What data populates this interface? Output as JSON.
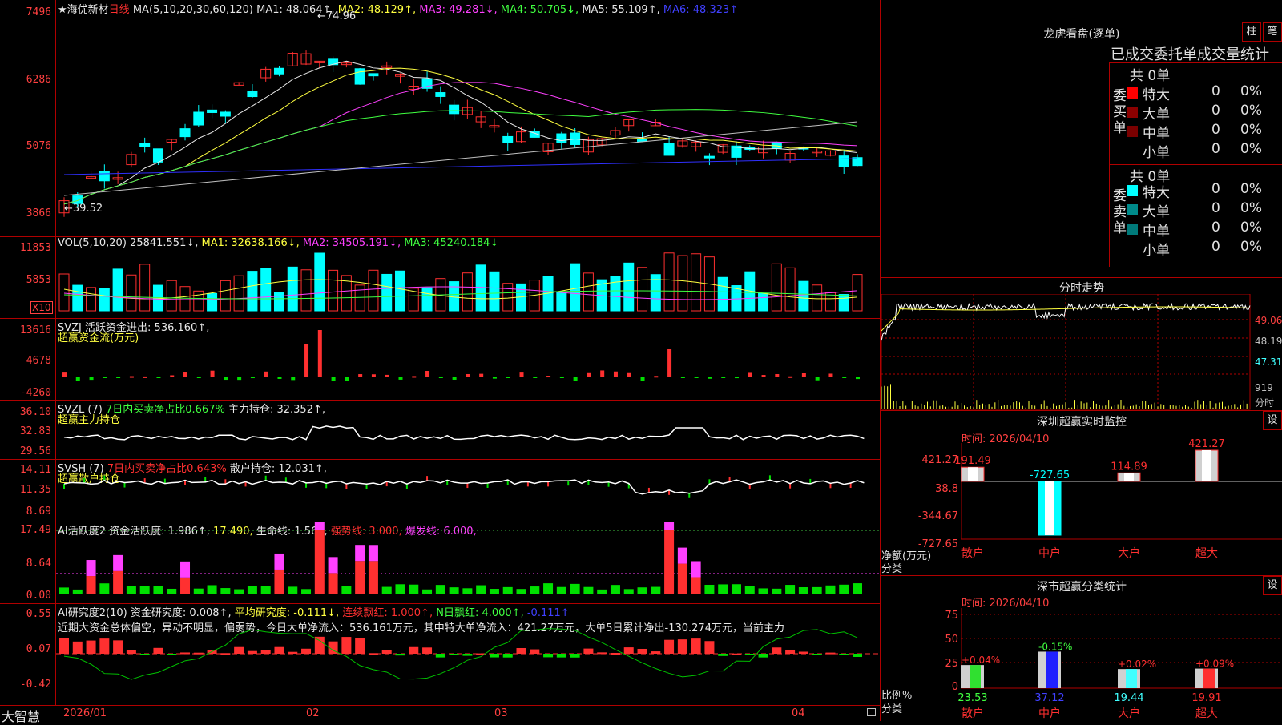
{
  "stock": {
    "name": "海优新材",
    "period": "日线"
  },
  "main": {
    "ma_params": "MA(5,10,20,30,60,120)",
    "ma1": "MA1: 48.064↑,",
    "ma2": "MA2: 48.129↑,",
    "ma3": "MA3: 49.281↓,",
    "ma4": "MA4: 50.705↓,",
    "ma5": "MA5: 55.109↑,",
    "ma6": "MA6: 48.323↑",
    "high_label": "74.96",
    "low_label": "39.52",
    "y_labels": [
      "7496",
      "6286",
      "5076",
      "3866"
    ]
  },
  "vol": {
    "params": "VOL(5,10,20)",
    "value": "25841.551↓,",
    "ma1": "MA1: 32638.166↓,",
    "ma2": "MA2: 34505.191↓,",
    "ma3": "MA3: 45240.184↓",
    "y_labels": [
      "11853",
      "5853"
    ],
    "unit": "X10"
  },
  "svzj": {
    "name": "SVZJ",
    "text": "活跃资金进出: 536.160↑,",
    "sub": "超赢资金流(万元)",
    "y_labels": [
      "13616",
      "4678",
      "-4260"
    ]
  },
  "svzl": {
    "name": "SVZL (7)",
    "ratio": "7日内买卖净占比0.667%",
    "hold": "主力持仓: 32.352↑,",
    "sub": "超赢主力持仓",
    "y_labels": [
      "36.10",
      "32.83",
      "29.56"
    ]
  },
  "svsh": {
    "name": "SVSH (7)",
    "ratio": "7日内买卖净占比0.643%",
    "hold": "散户持仓: 12.031↑,",
    "sub": "超赢散户持仓",
    "y_labels": [
      "14.11",
      "11.35",
      "8.69"
    ]
  },
  "ai2": {
    "name": "AI活跃度2",
    "activity": "资金活跃度: 1.986↑,",
    "v2": "17.490,",
    "life": "生命线: 1.560,",
    "strong": "强势线: 3.000,",
    "burst": "爆发线: 6.000,",
    "y_labels": [
      "17.49",
      "8.64",
      "0.00"
    ]
  },
  "ai_research": {
    "name": "AI研究度2(10)",
    "research": "资金研究度: 0.008↑,",
    "avg": "平均研究度: -0.111↓,",
    "consec": "连续飘红: 1.000↑,",
    "nday": "N日飘红: 4.000↑,",
    "last": "-0.111↑",
    "comment": "近期大资金总体偏空，异动不明显，偏弱势，今日大单净流入：536.161万元，其中特大单净流入：421.27万元，大单5日累计净出-130.274万元，当前主力",
    "y_labels": [
      "0.55",
      "0.07",
      "-0.42"
    ]
  },
  "x_axis": {
    "brand": "大智慧",
    "labels": [
      "2026/01",
      "02",
      "03",
      "04"
    ]
  },
  "right": {
    "lhb": {
      "title": "龙虎看盘(逐单)",
      "btn_bar": "柱",
      "btn_tick": "笔",
      "header": "已成交委托单成交量统计",
      "buy_side": "委买单",
      "sell_side": "委卖单",
      "buy_total": "共 0单",
      "sell_total": "共 0单",
      "buy_rows": [
        {
          "label": "特大",
          "count": "0",
          "pct": "0%",
          "color": "#ff0000"
        },
        {
          "label": "大单",
          "count": "0",
          "pct": "0%",
          "color": "#8b0000"
        },
        {
          "label": "中单",
          "count": "0",
          "pct": "0%",
          "color": "#7a0000"
        },
        {
          "label": "小单",
          "count": "0",
          "pct": "0%",
          "color": "#000000"
        }
      ],
      "sell_rows": [
        {
          "label": "特大",
          "count": "0",
          "pct": "0%",
          "color": "#00ffff"
        },
        {
          "label": "大单",
          "count": "0",
          "pct": "0%",
          "color": "#008b8b"
        },
        {
          "label": "中单",
          "count": "0",
          "pct": "0%",
          "color": "#007a7a"
        },
        {
          "label": "小单",
          "count": "0",
          "pct": "0%",
          "color": "#000000"
        }
      ]
    },
    "intraday": {
      "title": "分时走势",
      "y_labels": [
        "49.06",
        "48.19",
        "47.31",
        "919",
        "分时"
      ]
    },
    "sz_monitor": {
      "title": "深圳超赢实时监控",
      "btn": "设",
      "time": "时间: 2026/04/10",
      "y_labels": [
        "421.27",
        "38.8",
        "-344.67",
        "-727.65"
      ],
      "axis_title": "净额(万元)",
      "axis_sub": "分类",
      "categories": [
        "散户",
        "中户",
        "大户",
        "超大"
      ],
      "values": [
        "191.49",
        "-727.65",
        "114.89",
        "421.27"
      ]
    },
    "sz_class": {
      "title": "深市超赢分类统计",
      "btn": "设",
      "time": "时间: 2026/04/10",
      "y_labels": [
        "75",
        "50",
        "25",
        "0"
      ],
      "axis_title": "比例%",
      "axis_sub": "分类",
      "categories": [
        "散户",
        "中户",
        "大户",
        "超大"
      ],
      "pct_change": [
        "+0.04%",
        "-0.15%",
        "+0.02%",
        "+0.09%"
      ],
      "values": [
        "23.53",
        "37.12",
        "19.44",
        "19.91"
      ]
    }
  },
  "colors": {
    "up": "#ff3030",
    "down": "#00ffff",
    "grid": "#b00000"
  },
  "chart_data": [
    {
      "type": "bar",
      "title": "深圳超赢实时监控",
      "categories": [
        "散户",
        "中户",
        "大户",
        "超大"
      ],
      "values": [
        191.49,
        -727.65,
        114.89,
        421.27
      ],
      "ylabel": "净额(万元)",
      "ylim": [
        -727.65,
        421.27
      ]
    },
    {
      "type": "bar",
      "title": "深市超赢分类统计",
      "categories": [
        "散户",
        "中户",
        "大户",
        "超大"
      ],
      "values": [
        23.53,
        37.12,
        19.44,
        19.91
      ],
      "ylabel": "比例%",
      "ylim": [
        0,
        75
      ]
    }
  ]
}
